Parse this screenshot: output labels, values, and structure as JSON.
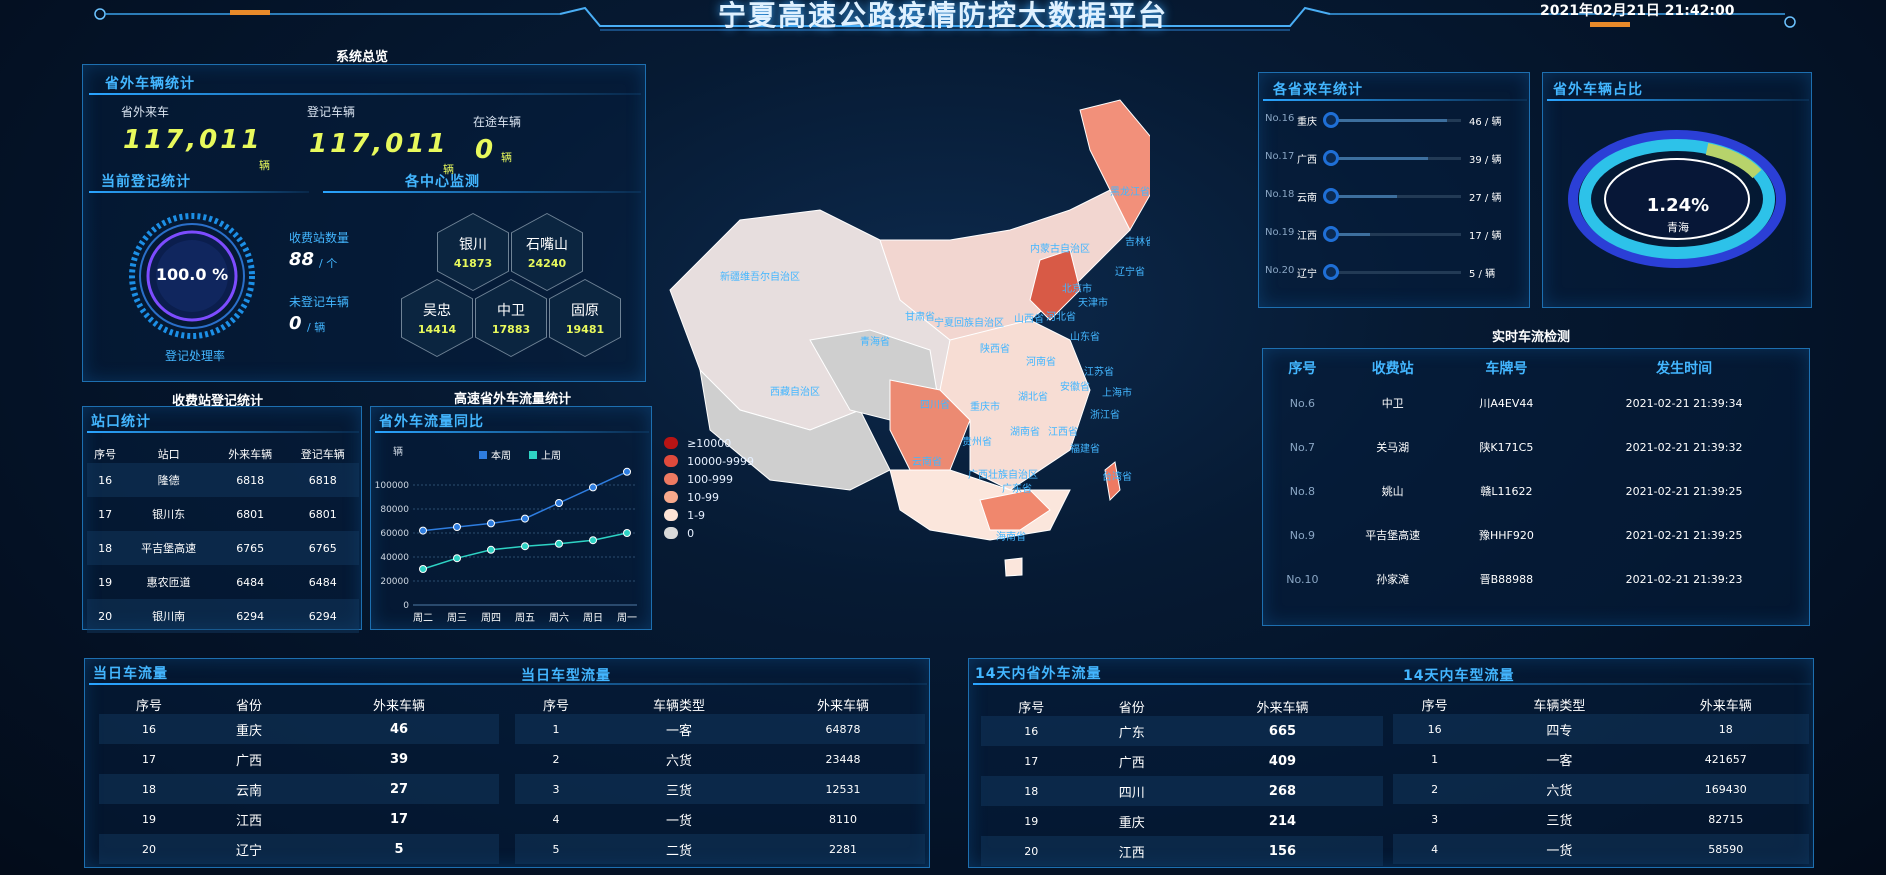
{
  "header": {
    "title": "宁夏高速公路疫情防控大数据平台",
    "datetime": "2021年02月21日 21:42:00"
  },
  "overview": {
    "section_title": "系统总览",
    "panel_title": "省外车辆统计",
    "stats": [
      {
        "label": "省外来车",
        "value": "117,011",
        "unit": "辆"
      },
      {
        "label": "登记车辆",
        "value": "117,011",
        "unit": "辆"
      },
      {
        "label": "在途车辆",
        "value": "0",
        "unit": "辆"
      }
    ]
  },
  "current_reg": {
    "title": "当前登记统计",
    "ring_value": "100.0 %",
    "ring_percent": 100,
    "ring_label": "登记处理率",
    "station_count_label": "收费站数量",
    "station_count": "88",
    "station_unit": "/ 个",
    "unreg_label": "未登记车辆",
    "unreg_value": "0",
    "unreg_unit": "/ 辆"
  },
  "centers": {
    "title": "各中心监测",
    "items": [
      {
        "name": "银川",
        "value": "41873"
      },
      {
        "name": "石嘴山",
        "value": "24240"
      },
      {
        "name": "吴忠",
        "value": "14414"
      },
      {
        "name": "中卫",
        "value": "17883"
      },
      {
        "name": "固原",
        "value": "19481"
      }
    ]
  },
  "toll": {
    "section_title": "收费站登记统计",
    "panel_title": "站口统计",
    "headers": [
      "序号",
      "站口",
      "外来车辆",
      "登记车辆"
    ],
    "rows": [
      [
        "16",
        "隆德",
        "6818",
        "6818"
      ],
      [
        "17",
        "银川东",
        "6801",
        "6801"
      ],
      [
        "18",
        "平吉堡高速",
        "6765",
        "6765"
      ],
      [
        "19",
        "惠农匝道",
        "6484",
        "6484"
      ],
      [
        "20",
        "银川南",
        "6294",
        "6294"
      ]
    ]
  },
  "flow_chart": {
    "section_title": "高速省外车流量统计",
    "panel_title": "省外车流量同比"
  },
  "chart_data": {
    "type": "line",
    "ylabel": "辆",
    "categories": [
      "周二",
      "周三",
      "周四",
      "周五",
      "周六",
      "周日",
      "周一"
    ],
    "ylim": [
      0,
      100000
    ],
    "yticks": [
      "100000",
      "80000",
      "60000",
      "40000",
      "20000",
      "0"
    ],
    "series": [
      {
        "name": "本周",
        "color": "#2e7de0",
        "values": [
          62000,
          65000,
          68000,
          72000,
          85000,
          98000,
          111000
        ]
      },
      {
        "name": "上周",
        "color": "#2ed3c4",
        "values": [
          30000,
          39000,
          46000,
          49000,
          51000,
          54000,
          60000
        ]
      }
    ],
    "legend_position": "top"
  },
  "map": {
    "legend": [
      {
        "label": "≥10000",
        "color": "#b81414"
      },
      {
        "label": "10000-9999",
        "color": "#e04a3c"
      },
      {
        "label": "100-999",
        "color": "#ee7a62"
      },
      {
        "label": "10-99",
        "color": "#f8a98c"
      },
      {
        "label": "1-9",
        "color": "#fde4d6"
      },
      {
        "label": "0",
        "color": "#d9d9d9"
      }
    ],
    "labels": [
      "新疆维吾尔自治区",
      "西藏自治区",
      "青海省",
      "甘肃省",
      "宁夏回族自治区",
      "内蒙古自治区",
      "黑龙江省",
      "吉林省",
      "辽宁省",
      "北京市",
      "天津市",
      "河北省",
      "山西省",
      "山东省",
      "陕西省",
      "河南省",
      "江苏省",
      "安徽省",
      "上海市",
      "浙江省",
      "湖北省",
      "四川省",
      "重庆市",
      "湖南省",
      "江西省",
      "福建省",
      "贵州省",
      "云南省",
      "广西壮族自治区",
      "广东省",
      "台湾省",
      "海南省"
    ]
  },
  "province_flow": {
    "title": "各省来车统计",
    "rows": [
      {
        "no": "No.16",
        "name": "重庆",
        "value": "46 / 辆",
        "fraction": 0.9
      },
      {
        "no": "No.17",
        "name": "广西",
        "value": "39 / 辆",
        "fraction": 0.76
      },
      {
        "no": "No.18",
        "name": "云南",
        "value": "27 / 辆",
        "fraction": 0.53
      },
      {
        "no": "No.19",
        "name": "江西",
        "value": "17 / 辆",
        "fraction": 0.33
      },
      {
        "no": "No.20",
        "name": "辽宁",
        "value": "5 / 辆",
        "fraction": 0.1
      }
    ]
  },
  "outside_ratio": {
    "title": "省外车辆占比",
    "value": "1.24%",
    "label": "青海"
  },
  "realtime": {
    "section_title": "实时车流检测",
    "headers": [
      "序号",
      "收费站",
      "车牌号",
      "发生时间"
    ],
    "rows": [
      [
        "No.6",
        "中卫",
        "川A4EV44",
        "2021-02-21 21:39:34"
      ],
      [
        "No.7",
        "关马湖",
        "陕K171C5",
        "2021-02-21 21:39:32"
      ],
      [
        "No.8",
        "姚山",
        "赣L11622",
        "2021-02-21 21:39:25"
      ],
      [
        "No.9",
        "平吉堡高速",
        "豫HHF920",
        "2021-02-21 21:39:25"
      ],
      [
        "No.10",
        "孙家滩",
        "晋B88988",
        "2021-02-21 21:39:23"
      ]
    ]
  },
  "day_flow": {
    "title_left": "当日车流量",
    "title_right": "当日车型流量",
    "left_headers": [
      "序号",
      "省份",
      "外来车辆"
    ],
    "left_rows": [
      [
        "16",
        "重庆",
        "46"
      ],
      [
        "17",
        "广西",
        "39"
      ],
      [
        "18",
        "云南",
        "27"
      ],
      [
        "19",
        "江西",
        "17"
      ],
      [
        "20",
        "辽宁",
        "5"
      ]
    ],
    "right_headers": [
      "序号",
      "车辆类型",
      "外来车辆"
    ],
    "right_rows": [
      [
        "1",
        "一客",
        "64878"
      ],
      [
        "2",
        "六货",
        "23448"
      ],
      [
        "3",
        "三货",
        "12531"
      ],
      [
        "4",
        "一货",
        "8110"
      ],
      [
        "5",
        "二货",
        "2281"
      ]
    ]
  },
  "fourteen_flow": {
    "title_left": "14天内省外车流量",
    "title_right": "14天内车型流量",
    "left_headers": [
      "序号",
      "省份",
      "外来车辆"
    ],
    "left_rows": [
      [
        "16",
        "广东",
        "665"
      ],
      [
        "17",
        "广西",
        "409"
      ],
      [
        "18",
        "四川",
        "268"
      ],
      [
        "19",
        "重庆",
        "214"
      ],
      [
        "20",
        "江西",
        "156"
      ]
    ],
    "right_headers": [
      "序号",
      "车辆类型",
      "外来车辆"
    ],
    "right_rows": [
      [
        "16",
        "四专",
        "18"
      ],
      [
        "1",
        "一客",
        "421657"
      ],
      [
        "2",
        "六货",
        "169430"
      ],
      [
        "3",
        "三货",
        "82715"
      ],
      [
        "4",
        "一货",
        "58590"
      ]
    ]
  }
}
